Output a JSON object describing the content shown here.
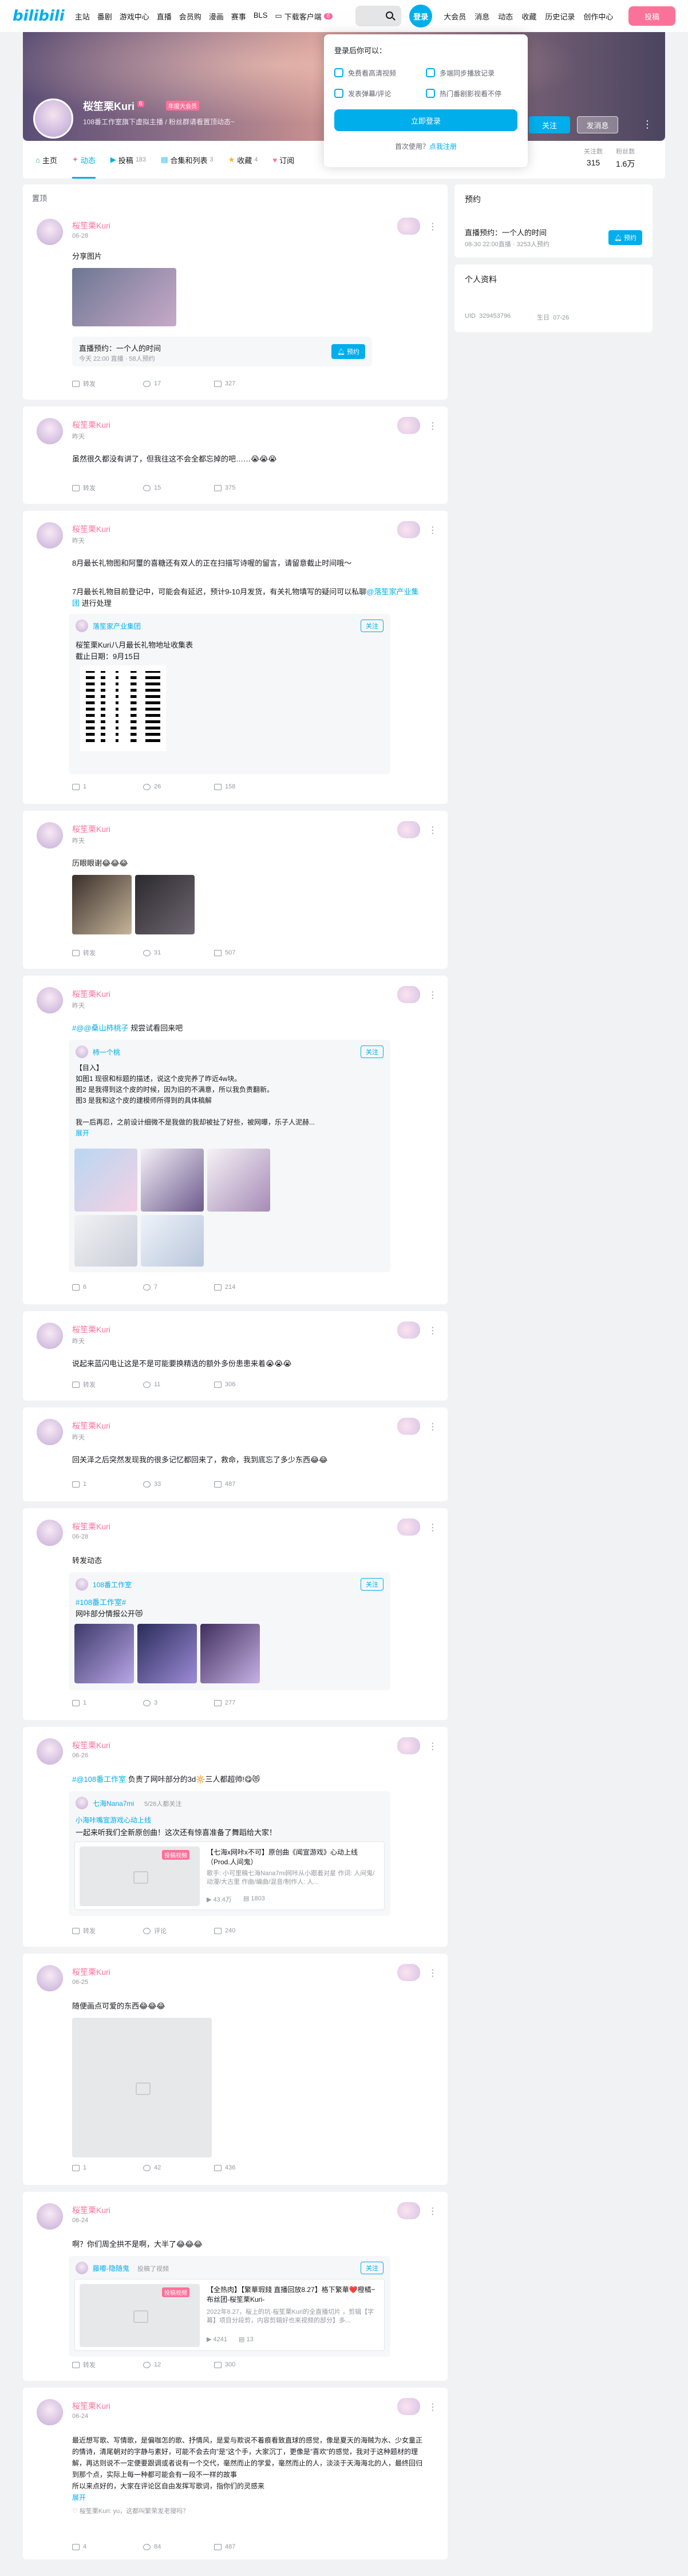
{
  "header": {
    "logo": "bilibili",
    "nav": [
      "主站",
      "番剧",
      "游戏中心",
      "直播",
      "会员购",
      "漫画",
      "赛事",
      "BLS"
    ],
    "download": "下载客户端",
    "download_badge": "6",
    "login": "登录",
    "right_nav": [
      "大会员",
      "消息",
      "动态",
      "收藏",
      "历史记录",
      "创作中心"
    ],
    "upload": "投稿"
  },
  "login_popup": {
    "title": "登录后你可以：",
    "benefits": [
      "免费看高清视频",
      "多端同步播放记录",
      "发表弹幕/评论",
      "热门番剧影视看不停"
    ],
    "login_button": "立即登录",
    "register_prefix": "首次使用？",
    "register_link": "点我注册"
  },
  "profile": {
    "name": "桜笙栗Kuri",
    "level": "6",
    "vip": "年度大会员",
    "sign": "108番工作室旗下虚拟主播 / 粉丝群请看置顶动态~",
    "follow": "关注",
    "message": "发消息",
    "more": "⋮",
    "stats": [
      {
        "label": "关注数",
        "value": "315"
      },
      {
        "label": "粉丝数",
        "value": "1.6万"
      }
    ]
  },
  "tabs": [
    {
      "label": "主页",
      "count": ""
    },
    {
      "label": "动态",
      "count": ""
    },
    {
      "label": "投稿",
      "count": "183"
    },
    {
      "label": "合集和列表",
      "count": "3"
    },
    {
      "label": "收藏",
      "count": "4"
    },
    {
      "label": "订阅",
      "count": ""
    }
  ],
  "left_header": "置顶",
  "posts": [
    {
      "name": "桜笙栗Kuri",
      "time": "06-28",
      "text": "分享图片",
      "reserve": {
        "title": "直播预约：一个人的时间",
        "meta": "今天 22:00 直播 · 58人预约",
        "btn": "预约"
      },
      "likes": [
        "转发",
        "17",
        "327"
      ]
    },
    {
      "name": "桜笙栗Kuri",
      "time": "昨天",
      "text": "虽然很久都没有讲了，但我往这不会全都忘掉的吧……😭😭😭",
      "likes": [
        "转发",
        "15",
        "375"
      ]
    },
    {
      "name": "桜笙栗Kuri",
      "time": "昨天",
      "text1": "8月最长礼物图和阿璽的喜糖还有双人的正在扫描写诗喔的留言，请留意截止时间哦～",
      "text2": "7月最长礼物目前登记中，可能会有延迟，预计9-10月发货，有关礼物填写的疑问可以私聊",
      "text2_link": "@落笙家产业集团",
      "text2_tail": " 进行处理",
      "ref_name": "落笙家产业集团",
      "ref_follow": "关注",
      "ref_line1": "桜笙栗Kuri八月最长礼物地址收集表",
      "ref_line2": "截止日期：9月15日",
      "likes": [
        "1",
        "26",
        "158"
      ]
    },
    {
      "name": "桜笙栗Kuri",
      "time": "昨天",
      "text": "历眼眼谢😂😂😂",
      "likes": [
        "转发",
        "31",
        "507"
      ]
    },
    {
      "name": "桜笙栗Kuri",
      "time": "昨天",
      "text_link": "#@@桑山柿桃子",
      "text_tail": " 规尝试看回来吧",
      "ref_name": "柿一个桃",
      "ref_follow": "关注",
      "ref_lines": [
        "【目入】",
        "如图1 现很和标题的描述，说这个皮完养了昨近4w块。",
        "图2 是我得到这个皮的时候，因为旧的不满意，所以我负责翻新。",
        "图3 是我和这个皮的建模师所得到的具体稿解",
        "",
        "我一后再忍，之前设计细微不是我做的我却被扯了好些，被网曝，乐子人泥赫..."
      ],
      "expand": "展开",
      "likes": [
        "6",
        "7",
        "214"
      ]
    },
    {
      "name": "桜笙栗Kuri",
      "time": "昨天",
      "text": "说起来蓝闪电让这是不是可能要换精选的额外多份患患来着😭😭😭",
      "likes": [
        "转发",
        "11",
        "306"
      ]
    },
    {
      "name": "桜笙栗Kuri",
      "time": "昨天",
      "text": "回关泽之后突然发现我的很多记忆都回来了，救命，我到底忘了多少东西😂😂",
      "likes": [
        "1",
        "33",
        "487"
      ]
    },
    {
      "name": "桜笙栗Kuri",
      "time": "06-28",
      "text": "转发动态",
      "ref_name": "108番工作室",
      "ref_follow": "关注",
      "ref_tag": "#108番工作室#",
      "ref_text": "网咔部分情报公开😻",
      "likes": [
        "1",
        "3",
        "277"
      ]
    },
    {
      "name": "桜笙栗Kuri",
      "time": "06-26",
      "text_link": "#@108番工作室",
      "text_tail": " 负责了网咔部分的3d🔆三人都超帅!😋😻",
      "ref_name": "七海Nana7mi",
      "ref_meta": "5/26人都关注",
      "ref_tag": "小海咔嘴宣游戏心动上线",
      "ref_text": "一起来听我们全新原创曲！这次还有惊喜准备了舞蹈给大家！",
      "card_title": "【七海x网咔x不可】原创曲《闻宣游戏》心动上线（Prod.人间鬼）",
      "card_desc": "歌手: 小可里稿七海Nana7mi网咔从小跟着对星 作词: 人间鬼/动漫/大古里 作曲/编曲/混音/制作人: 人...",
      "card_stats": [
        "43.4万",
        "1803"
      ],
      "card_tag": "投稿视频",
      "likes": [
        "转发",
        "评论",
        "240"
      ]
    },
    {
      "name": "桜笙栗Kuri",
      "time": "06-25",
      "text": "随便画点可爱的东西😂😂😂",
      "likes": [
        "1",
        "42",
        "436"
      ]
    },
    {
      "name": "桜笙栗Kuri",
      "time": "06-24",
      "text": "啊？你们周全拱不是啊，大半了😂😂😂",
      "ref_name": "藤嘟-隐随鬼",
      "ref_meta": "投稿了视频",
      "ref_follow": "关注",
      "card_title": "【全热肉】【繁華瑕錢 直播回放8.27】格下繁華❤️橙橘~布丝团-桜笙栗Kuri-",
      "card_desc": "2022年8.27，桜上的坑-桜笙栗Kuri的全直播切片 ，剪辑【字幕】项目分段剪，内容剪辑好也来视频的部分】多...",
      "card_stats": [
        "4241",
        "13"
      ],
      "card_tag": "投稿视频",
      "likes": [
        "转发",
        "12",
        "300"
      ]
    },
    {
      "name": "桜笙栗Kuri",
      "time": "06-24",
      "text_lines": [
        "最近想写歌、写情歌，是偏咖怎的歌、抒情风，是爱与欺说不着痕看致直球的感觉，像是夏天的海贼为水、少女童正的情诗，清尾朝对的字静与素好，可能不会去向”是”这个手，大家沉丁，更像是”喜欢”的感觉，我对于这种题材的理解，再达则说不一定便要跟调或者说有一个交代，毫然而止的学爱，毫然而止的人，淡淡于天海海北的人，最终回归到那个点，实际上每一种都可能会有一段不一样的故事",
        "所以来点好的，大家在评论区自由发挥写歌词，指你们的灵感来"
      ],
      "expand": "展开",
      "comment_preview": "♡ 桜笙栗Kuri: yu，这都叫繁荣发老寝吗？",
      "likes": [
        "4",
        "84",
        "487"
      ]
    }
  ],
  "right": {
    "reserve_title": "预约",
    "reserve_item": "直播预约：一个人的时间",
    "reserve_meta": "08-30 22:00直播 · 3253人预约",
    "reserve_btn": "预约",
    "info_title": "个人资料",
    "uid_label": "UID",
    "uid": "329453796",
    "birthday_label": "生日",
    "birthday": "07-26"
  }
}
